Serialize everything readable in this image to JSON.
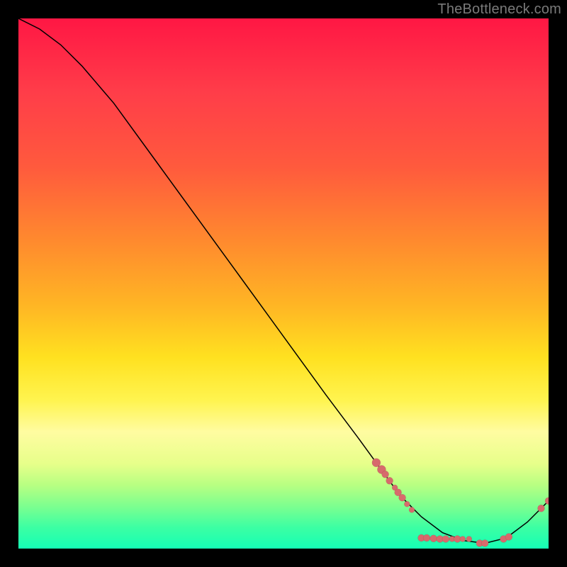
{
  "watermark": "TheBottleneck.com",
  "colors": {
    "background": "#000000",
    "curve": "#000000",
    "marker": "#d76a6c",
    "gradient_top": "#ff1744",
    "gradient_bottom": "#15ffb5",
    "watermark": "#7a7a7a"
  },
  "chart_data": {
    "type": "line",
    "title": "",
    "xlabel": "",
    "ylabel": "",
    "xlim": [
      0,
      100
    ],
    "ylim": [
      0,
      100
    ],
    "grid": false,
    "legend": false,
    "curve": [
      {
        "x": 0,
        "y": 100
      },
      {
        "x": 4,
        "y": 98
      },
      {
        "x": 8,
        "y": 95
      },
      {
        "x": 12,
        "y": 91
      },
      {
        "x": 18,
        "y": 84
      },
      {
        "x": 26,
        "y": 73
      },
      {
        "x": 34,
        "y": 62
      },
      {
        "x": 42,
        "y": 51
      },
      {
        "x": 50,
        "y": 40
      },
      {
        "x": 58,
        "y": 29
      },
      {
        "x": 64,
        "y": 21
      },
      {
        "x": 68,
        "y": 15.5
      },
      {
        "x": 72,
        "y": 10
      },
      {
        "x": 76,
        "y": 6
      },
      {
        "x": 80,
        "y": 3
      },
      {
        "x": 84,
        "y": 1.5
      },
      {
        "x": 88,
        "y": 1
      },
      {
        "x": 92,
        "y": 2
      },
      {
        "x": 96,
        "y": 5
      },
      {
        "x": 100,
        "y": 9
      }
    ],
    "markers": [
      {
        "x": 67.5,
        "y": 16.2,
        "r": 6
      },
      {
        "x": 68.5,
        "y": 14.9,
        "r": 6
      },
      {
        "x": 69.2,
        "y": 14.0,
        "r": 5
      },
      {
        "x": 70.0,
        "y": 12.8,
        "r": 5
      },
      {
        "x": 71.0,
        "y": 11.5,
        "r": 4
      },
      {
        "x": 71.6,
        "y": 10.6,
        "r": 5
      },
      {
        "x": 72.4,
        "y": 9.6,
        "r": 5
      },
      {
        "x": 73.3,
        "y": 8.4,
        "r": 4
      },
      {
        "x": 74.2,
        "y": 7.3,
        "r": 4
      },
      {
        "x": 76.0,
        "y": 2.0,
        "r": 5
      },
      {
        "x": 77.0,
        "y": 2.0,
        "r": 5
      },
      {
        "x": 78.3,
        "y": 1.9,
        "r": 5
      },
      {
        "x": 79.5,
        "y": 1.8,
        "r": 5
      },
      {
        "x": 80.6,
        "y": 1.8,
        "r": 5
      },
      {
        "x": 81.8,
        "y": 1.8,
        "r": 4
      },
      {
        "x": 82.8,
        "y": 1.8,
        "r": 5
      },
      {
        "x": 83.8,
        "y": 1.8,
        "r": 4
      },
      {
        "x": 85.0,
        "y": 1.8,
        "r": 4
      },
      {
        "x": 87.0,
        "y": 1.0,
        "r": 5
      },
      {
        "x": 88.0,
        "y": 1.0,
        "r": 5
      },
      {
        "x": 91.5,
        "y": 1.8,
        "r": 5
      },
      {
        "x": 92.5,
        "y": 2.2,
        "r": 5
      },
      {
        "x": 98.6,
        "y": 7.6,
        "r": 5
      },
      {
        "x": 100,
        "y": 9.0,
        "r": 5
      }
    ]
  }
}
